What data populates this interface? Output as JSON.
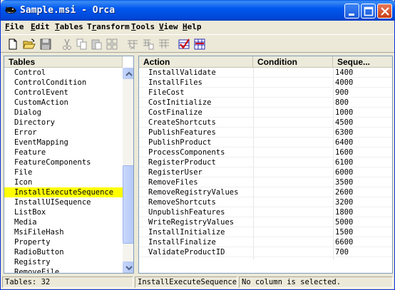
{
  "window": {
    "title": "Sample.msi - Orca",
    "icon": "orca-whale-icon"
  },
  "titlebar_buttons": [
    "minimize",
    "maximize",
    "close"
  ],
  "menu": [
    {
      "label": "File",
      "accel": "F",
      "rest": "ile"
    },
    {
      "label": "Edit",
      "accel": "E",
      "rest": "dit"
    },
    {
      "label": "Tables",
      "accel": "T",
      "rest": "ables"
    },
    {
      "label": "Transform",
      "accel": "r",
      "pre": "T",
      "rest": "ansform"
    },
    {
      "label": "Tools",
      "accel": "T",
      "rest": "ools"
    },
    {
      "label": "View",
      "accel": "V",
      "rest": "iew"
    },
    {
      "label": "Help",
      "accel": "H",
      "rest": "elp"
    }
  ],
  "toolbar": [
    "new-file-icon",
    "open-folder-icon",
    "save-icon",
    "cut-icon",
    "copy-icon",
    "paste-icon",
    "find-icon",
    "table-cut-icon",
    "table-copy-icon",
    "table-paste-icon",
    "validate-icon",
    "transform-icon"
  ],
  "tables_pane": {
    "header": "Tables",
    "items": [
      "Control",
      "ControlCondition",
      "ControlEvent",
      "CustomAction",
      "Dialog",
      "Directory",
      "Error",
      "EventMapping",
      "Feature",
      "FeatureComponents",
      "File",
      "Icon",
      "InstallExecuteSequence",
      "InstallUISequence",
      "ListBox",
      "Media",
      "MsiFileHash",
      "Property",
      "RadioButton",
      "Registry",
      "RemoveFile"
    ],
    "selected": "InstallExecuteSequence"
  },
  "grid": {
    "columns": [
      "Action",
      "Condition",
      "Seque..."
    ],
    "rows": [
      {
        "action": "InstallValidate",
        "condition": "",
        "sequence": "1400"
      },
      {
        "action": "InstallFiles",
        "condition": "",
        "sequence": "4000"
      },
      {
        "action": "FileCost",
        "condition": "",
        "sequence": "900"
      },
      {
        "action": "CostInitialize",
        "condition": "",
        "sequence": "800"
      },
      {
        "action": "CostFinalize",
        "condition": "",
        "sequence": "1000"
      },
      {
        "action": "CreateShortcuts",
        "condition": "",
        "sequence": "4500"
      },
      {
        "action": "PublishFeatures",
        "condition": "",
        "sequence": "6300"
      },
      {
        "action": "PublishProduct",
        "condition": "",
        "sequence": "6400"
      },
      {
        "action": "ProcessComponents",
        "condition": "",
        "sequence": "1600"
      },
      {
        "action": "RegisterProduct",
        "condition": "",
        "sequence": "6100"
      },
      {
        "action": "RegisterUser",
        "condition": "",
        "sequence": "6000"
      },
      {
        "action": "RemoveFiles",
        "condition": "",
        "sequence": "3500"
      },
      {
        "action": "RemoveRegistryValues",
        "condition": "",
        "sequence": "2600"
      },
      {
        "action": "RemoveShortcuts",
        "condition": "",
        "sequence": "3200"
      },
      {
        "action": "UnpublishFeatures",
        "condition": "",
        "sequence": "1800"
      },
      {
        "action": "WriteRegistryValues",
        "condition": "",
        "sequence": "5000"
      },
      {
        "action": "InstallInitialize",
        "condition": "",
        "sequence": "1500"
      },
      {
        "action": "InstallFinalize",
        "condition": "",
        "sequence": "6600"
      },
      {
        "action": "ValidateProductID",
        "condition": "",
        "sequence": "700"
      }
    ]
  },
  "status": {
    "tables_count": "Tables: 32",
    "current_table": "InstallExecuteSequence -",
    "message": "No column is selected."
  }
}
